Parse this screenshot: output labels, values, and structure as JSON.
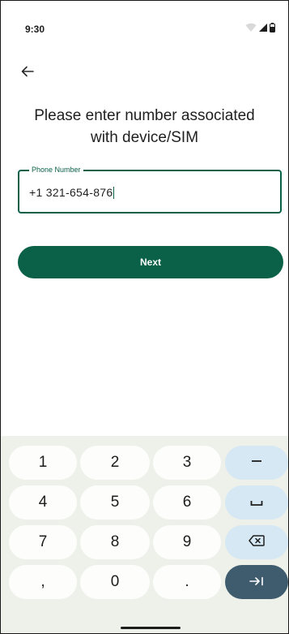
{
  "status_bar": {
    "time": "9:30",
    "icons": [
      "wifi-icon",
      "cellular-signal-icon",
      "battery-icon"
    ]
  },
  "header": {
    "back_icon": "arrow-left-icon"
  },
  "main": {
    "title": "Please enter number associated\nwith device/SIM",
    "phone_field": {
      "label": "Phone Number",
      "value": "+1 321-654-876"
    },
    "next_label": "Next"
  },
  "keyboard": {
    "rows": [
      [
        "1",
        "2",
        "3"
      ],
      [
        "4",
        "5",
        "6"
      ],
      [
        "7",
        "8",
        "9"
      ],
      [
        ",",
        "0",
        "."
      ]
    ],
    "function_keys": [
      "minus-icon",
      "space-icon",
      "backspace-icon",
      "tab-next-icon"
    ]
  },
  "colors": {
    "primary": "#0a6148",
    "keyboard_background": "#eef1ea",
    "key_background": "#fdfdfb",
    "function_key_background": "#d6e8f4",
    "enter_key_background": "#3f5c6e"
  }
}
